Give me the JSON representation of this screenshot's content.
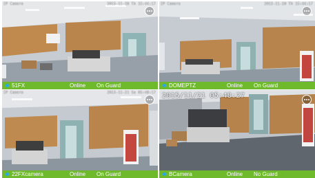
{
  "colors": {
    "status_bar": "#6fba2c",
    "status_dot": "#2aa6e8"
  },
  "cameras": [
    {
      "name": "51FX",
      "online": "Online",
      "guard": "On Guard",
      "osd_left": "IP Camera",
      "osd_right": "2015-11-20 Th 15:44:17",
      "osd_big": ""
    },
    {
      "name": "DOMEPTZ",
      "online": "Online",
      "guard": "On Guard",
      "osd_left": "IP Camera",
      "osd_right": "2015-11-20 Th 15:44:17",
      "osd_big": ""
    },
    {
      "name": "22FXcamera",
      "online": "Online",
      "guard": "On Guard",
      "osd_left": "IP Camera",
      "osd_right": "2015-11-21 Sa 05:48:17",
      "osd_big": ""
    },
    {
      "name": "BCamera",
      "online": "Online",
      "guard": "No Guard",
      "osd_left": "",
      "osd_right": "",
      "osd_big": "2015/11/21 05:48:27"
    }
  ]
}
